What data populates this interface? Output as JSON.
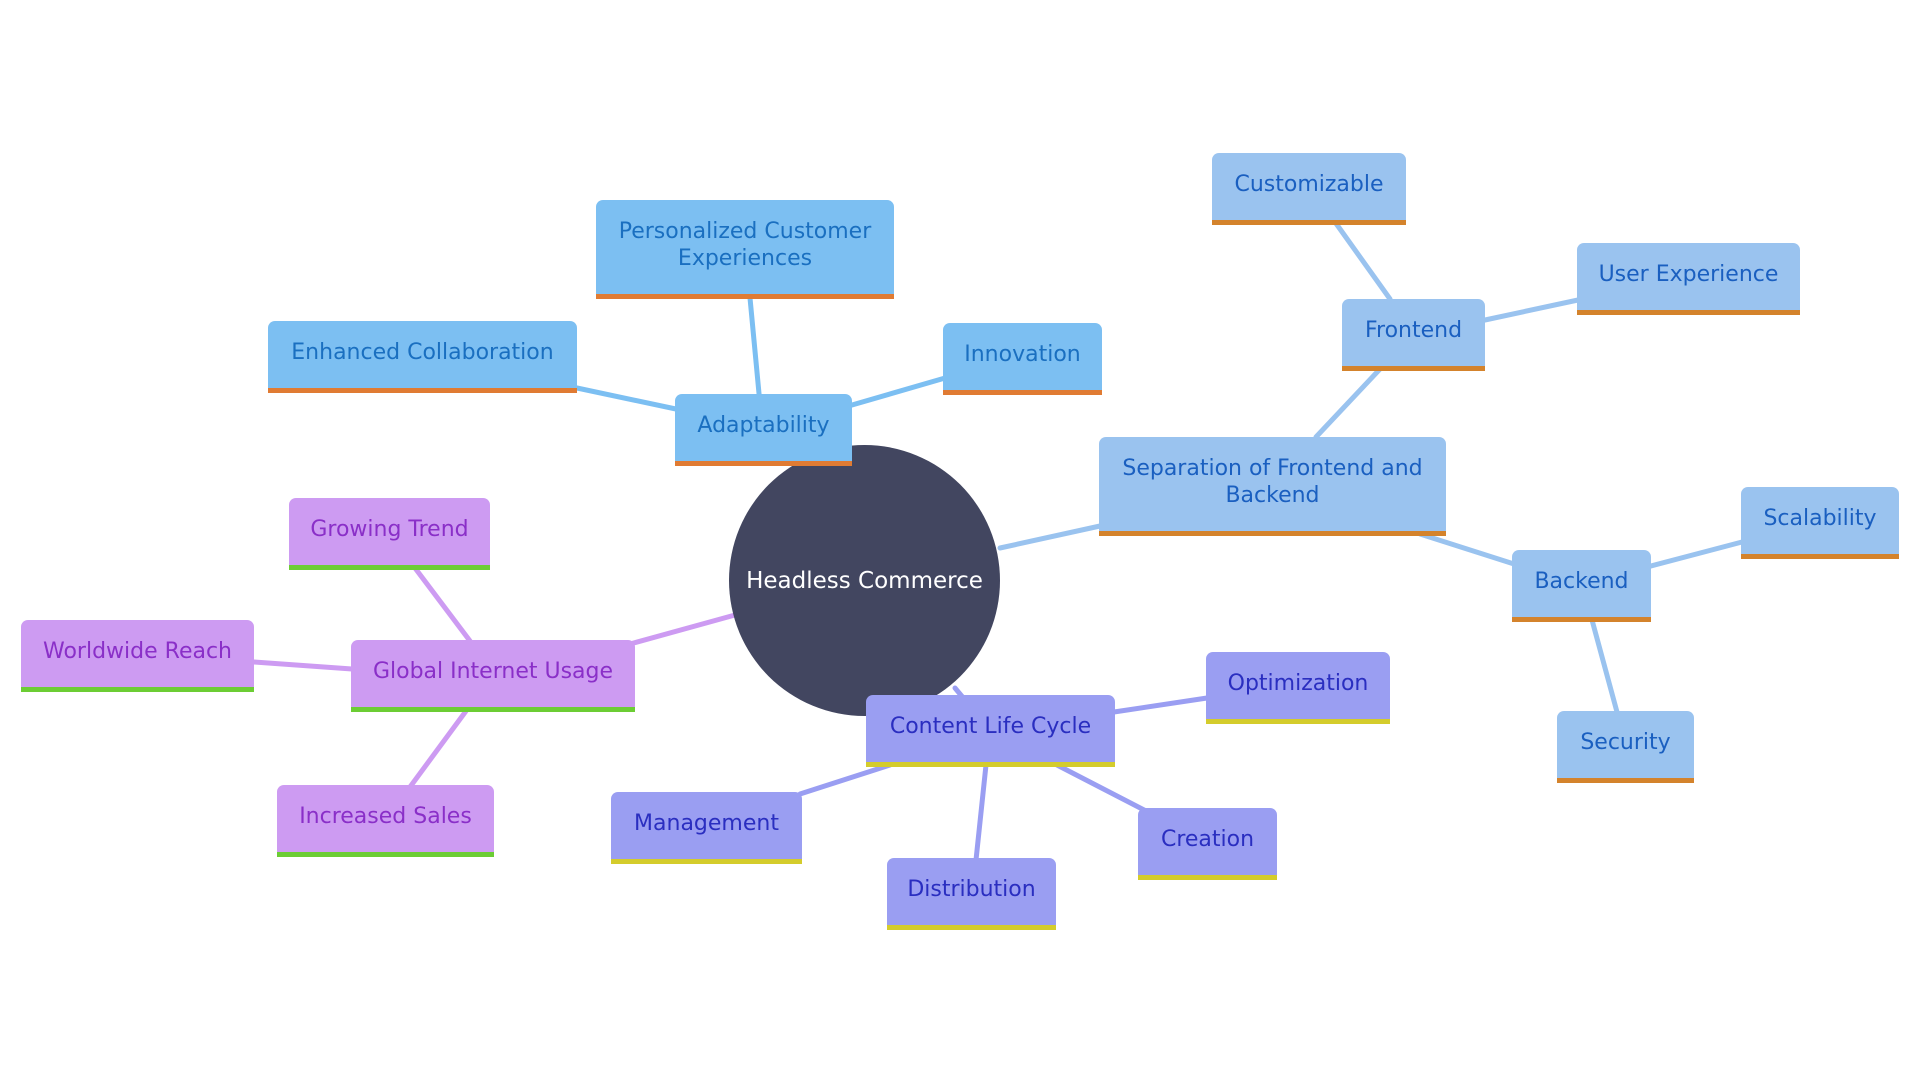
{
  "diagram": {
    "type": "mindmap",
    "root": {
      "label": "Headless Commerce"
    },
    "branches": [
      {
        "id": "adaptability",
        "label": "Adaptability",
        "colors": {
          "fill": "#7cbff2",
          "text": "#1a6fc0",
          "underline": "#e07b33",
          "edge": "#7cbff2"
        },
        "children": [
          {
            "label": "Personalized Customer Experiences"
          },
          {
            "label": "Enhanced Collaboration"
          },
          {
            "label": "Innovation"
          }
        ]
      },
      {
        "id": "separation",
        "label": "Separation of Frontend and Backend",
        "colors": {
          "fill": "#9ac3ef",
          "text": "#1a5fc0",
          "underline": "#d4832c",
          "edge": "#9ac3ef"
        },
        "children": [
          {
            "label": "Frontend",
            "children": [
              {
                "label": "Customizable"
              },
              {
                "label": "User Experience"
              }
            ]
          },
          {
            "label": "Backend",
            "children": [
              {
                "label": "Scalability"
              },
              {
                "label": "Security"
              }
            ]
          }
        ]
      },
      {
        "id": "global",
        "label": "Global Internet Usage",
        "colors": {
          "fill": "#cd9bf2",
          "text": "#8a2fc8",
          "underline": "#6ccd34",
          "edge": "#cd9bf2"
        },
        "children": [
          {
            "label": "Growing Trend"
          },
          {
            "label": "Worldwide Reach"
          },
          {
            "label": "Increased Sales"
          }
        ]
      },
      {
        "id": "content",
        "label": "Content Life Cycle",
        "colors": {
          "fill": "#9a9ef2",
          "text": "#2a2ec0",
          "underline": "#d4cc2c",
          "edge": "#9a9ef2"
        },
        "children": [
          {
            "label": "Optimization"
          },
          {
            "label": "Management"
          },
          {
            "label": "Distribution"
          },
          {
            "label": "Creation"
          }
        ]
      }
    ]
  }
}
